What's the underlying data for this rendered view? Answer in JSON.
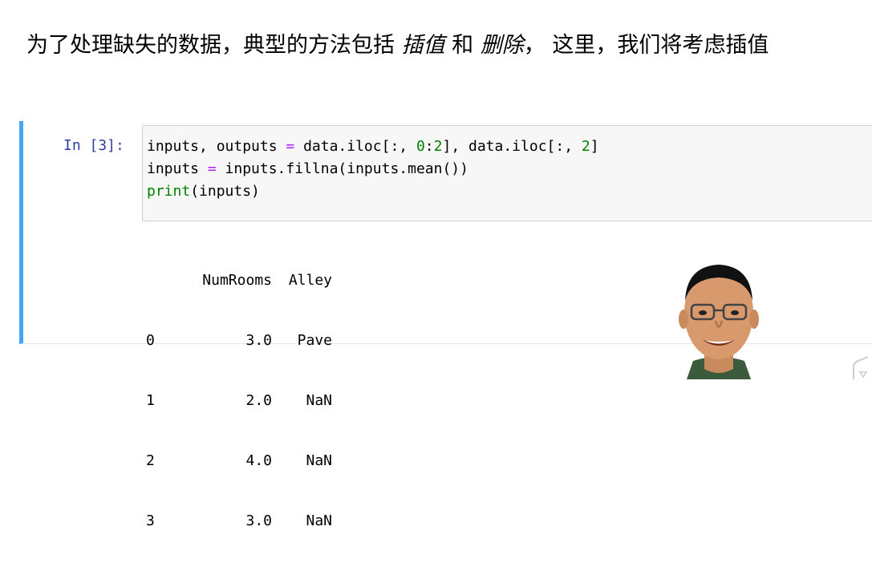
{
  "markdown": {
    "part1": "为了处理缺失的数据，典型的方法包括 ",
    "term1": "插值",
    "part2": " 和 ",
    "term2": "删除",
    "part3": "， 这里，我们将考虑插值"
  },
  "cell": {
    "prompt": "In [3]:",
    "code_lines": [
      "inputs, outputs = data.iloc[:, 0:2], data.iloc[:, 2]",
      "inputs = inputs.fillna(inputs.mean())",
      "print(inputs)"
    ],
    "output": {
      "header": [
        "",
        "NumRooms",
        "Alley"
      ],
      "rows": [
        [
          "0",
          "3.0",
          "Pave"
        ],
        [
          "1",
          "2.0",
          "NaN"
        ],
        [
          "2",
          "4.0",
          "NaN"
        ],
        [
          "3",
          "3.0",
          "NaN"
        ]
      ]
    }
  },
  "colors": {
    "prompt": "#303f9f",
    "cell_border": "#42a5f5",
    "builtin": "#008000",
    "operator": "#aa22ff"
  }
}
